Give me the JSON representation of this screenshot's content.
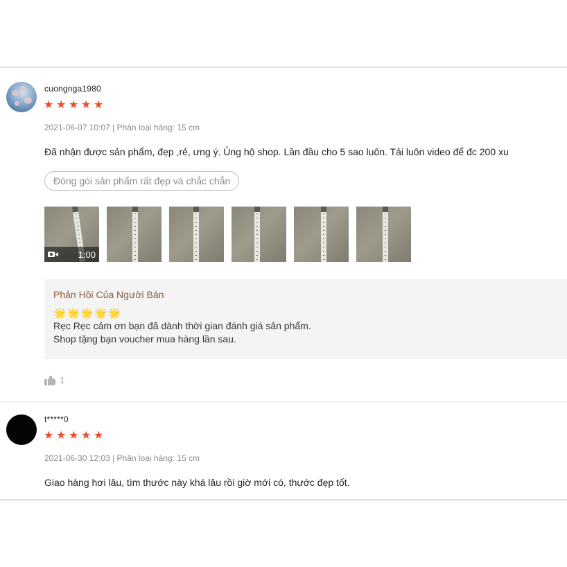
{
  "reviews": [
    {
      "username": "cuongnga1980",
      "rating": 5,
      "avatar": "photo-avatar",
      "meta": "2021-06-07 10:07 | Phân loại hàng: 15 cm",
      "text": "Đã nhận được sản phẩm, đẹp ,rẻ, ưng ý. Ủng hộ shop. Lần đầu cho 5 sao luôn. Tải luôn video để đc 200 xu",
      "tag": "Đóng gói sản phẩm rất đẹp và chắc chắn",
      "media": [
        {
          "type": "video",
          "duration": "1:00"
        },
        {
          "type": "image"
        },
        {
          "type": "image"
        },
        {
          "type": "image"
        },
        {
          "type": "image"
        },
        {
          "type": "image"
        }
      ],
      "seller_reply": {
        "title": "Phản Hồi Của Người Bán",
        "emoji": "🌟🌟🌟🌟🌟",
        "lines": [
          "Rẹc Rẹc cảm ơn bạn đã dành thời gian đánh giá sản phẩm.",
          "Shop tặng bạn voucher mua hàng lần sau."
        ]
      },
      "likes": "1"
    },
    {
      "username": "t*****0",
      "rating": 5,
      "avatar": "dark-avatar",
      "meta": "2021-06-30 12:03 | Phân loại hàng: 15 cm",
      "text": "Giao hàng hơi lâu, tìm thước này khá lâu rồi giờ mới có, thước đẹp tốt."
    }
  ],
  "icons": {
    "star": "star-icon",
    "video": "video-camera-icon",
    "like": "thumbs-up-icon"
  },
  "colors": {
    "star": "#ee4d2d",
    "seller_title": "#8a5a3c",
    "reply_bg": "#f4f4f4"
  }
}
